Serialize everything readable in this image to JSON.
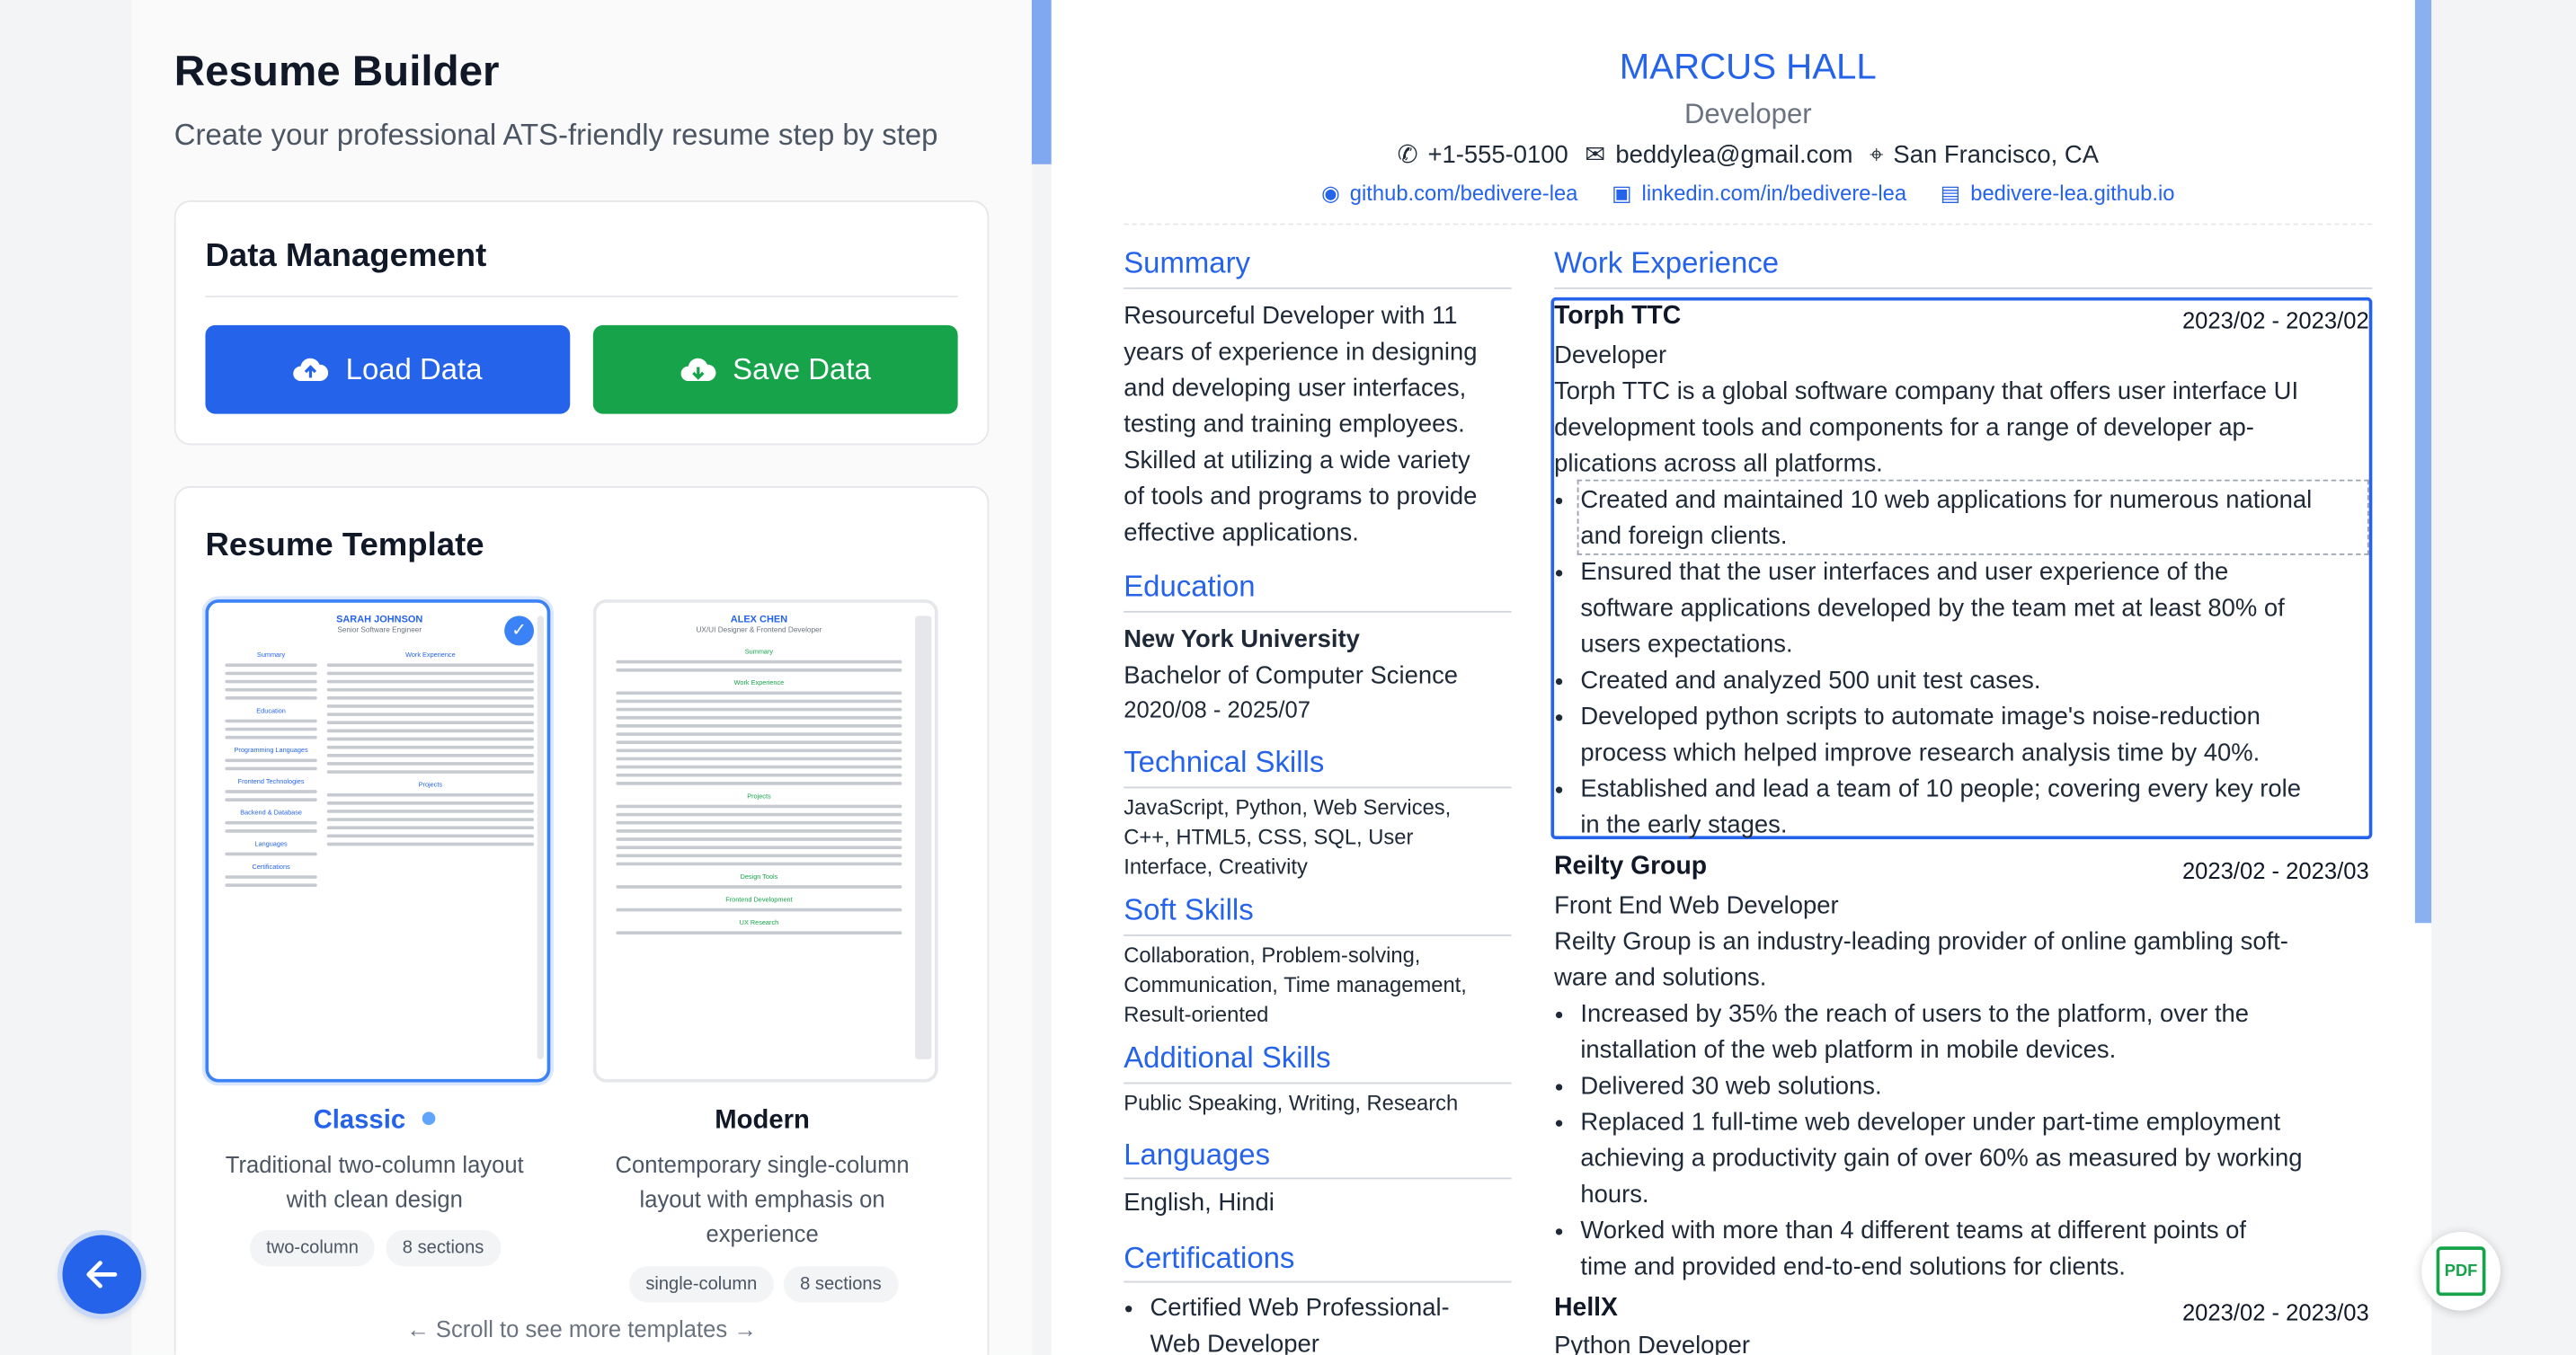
{
  "builder": {
    "title": "Resume Builder",
    "subtitle": "Create your professional ATS-friendly resume step by step",
    "data_management": {
      "title": "Data Management",
      "load_label": "Load Data",
      "save_label": "Save Data"
    },
    "templates": {
      "title": "Resume Template",
      "items": [
        {
          "name": "Classic",
          "description": "Traditional two-column layout with clean design",
          "tags": [
            "two-column",
            "8 sections"
          ],
          "selected": true,
          "preview": {
            "name": "SARAH JOHNSON",
            "role": "Senior Software Engineer",
            "sections": [
              "Summary",
              "Work Experience",
              "Education",
              "Programming Languages",
              "Frontend Technologies",
              "Backend & Database",
              "Languages",
              "Projects",
              "Certifications"
            ]
          }
        },
        {
          "name": "Modern",
          "description": "Contemporary single-column layout with emphasis on experience",
          "tags": [
            "single-column",
            "8 sections"
          ],
          "selected": false,
          "preview": {
            "name": "ALEX CHEN",
            "role": "UX/UI Designer & Frontend Developer",
            "sections": [
              "Summary",
              "Work Experience",
              "Projects",
              "Design Tools",
              "Frontend Development",
              "UX Research"
            ]
          }
        }
      ],
      "scroll_hint": "← Scroll to see more templates →"
    }
  },
  "resume": {
    "name": "MARCUS HALL",
    "title": "Developer",
    "phone": "+1-555-0100",
    "email": "beddylea@gmail.com",
    "location": "San Francisco, CA",
    "github": "github.com/bedivere-lea",
    "linkedin": "linkedin.com/in/bedivere-lea",
    "website": "bedivere-lea.github.io",
    "sections": {
      "summary": "Summary",
      "education": "Education",
      "technical_skills": "Technical Skills",
      "soft_skills": "Soft Skills",
      "additional_skills": "Additional Skills",
      "languages": "Languages",
      "certifications": "Certifications",
      "work_experience": "Work Experience"
    },
    "summary_lines": [
      "Resourceful Developer with 11",
      "years of experience in designing",
      "and developing user interfaces,",
      "testing and training employees.",
      "Skilled at utilizing a wide variety",
      "of tools and programs to provide",
      "effective applications."
    ],
    "education": {
      "school": "New York University",
      "degree": "Bachelor of Computer Science",
      "dates": "2020/08 - 2025/07"
    },
    "technical_skills_lines": [
      "JavaScript, Python, Web Services,",
      "C++, HTML5, CSS, SQL, User",
      "Interface, Creativity"
    ],
    "soft_skills_lines": [
      "Collaboration, Problem-solving,",
      "Communication, Time management,",
      "Result-oriented"
    ],
    "additional_skills": "Public Speaking, Writing, Research",
    "languages": "English, Hindi",
    "certifications_lines": [
      "Certified Web Professional-",
      "Web Developer"
    ],
    "jobs": [
      {
        "company": "Torph TTC",
        "dates": "2023/02 - 2023/02",
        "role": "Developer",
        "desc_lines": [
          "Torph TTC is a global software company that offers user interface UI",
          "development tools and components for a range of developer ap-",
          "plications across all platforms."
        ],
        "bullets": [
          [
            "Created and maintained 10 web applications for numerous national",
            "and foreign clients."
          ],
          [
            "Ensured that the user interfaces and user experience of the",
            "software applications developed by the team met at least 80% of",
            "users expectations."
          ],
          [
            "Created and analyzed 500 unit test cases."
          ],
          [
            "Developed python scripts to automate image's noise-reduction",
            "process which helped improve research analysis time by 40%."
          ],
          [
            "Established and lead a team of 10 people; covering every key role",
            "in the early stages."
          ]
        ]
      },
      {
        "company": "Reilty Group",
        "dates": "2023/02 - 2023/03",
        "role": "Front End Web Developer",
        "desc_lines": [
          "Reilty Group is an industry-leading provider of online gambling soft-",
          "ware and solutions."
        ],
        "bullets": [
          [
            "Increased by 35% the reach of users to the platform, over the",
            "installation of the web platform in mobile devices."
          ],
          [
            "Delivered 30 web solutions."
          ],
          [
            "Replaced 1 full-time web developer under part-time employment",
            "achieving a productivity gain of over 60% as measured by working",
            "hours."
          ],
          [
            "Worked with more than 4 different teams at different points of",
            "time and provided end-to-end solutions for clients."
          ]
        ]
      },
      {
        "company": "HellX",
        "dates": "2023/02 - 2023/03",
        "role": "Python Developer"
      }
    ]
  },
  "fab": {
    "back_icon": "arrow-left-icon",
    "pdf_label": "PDF"
  },
  "colors": {
    "accent": "#2563eb",
    "save": "#16a34a",
    "text": "#1f2937",
    "muted": "#6b7280"
  }
}
